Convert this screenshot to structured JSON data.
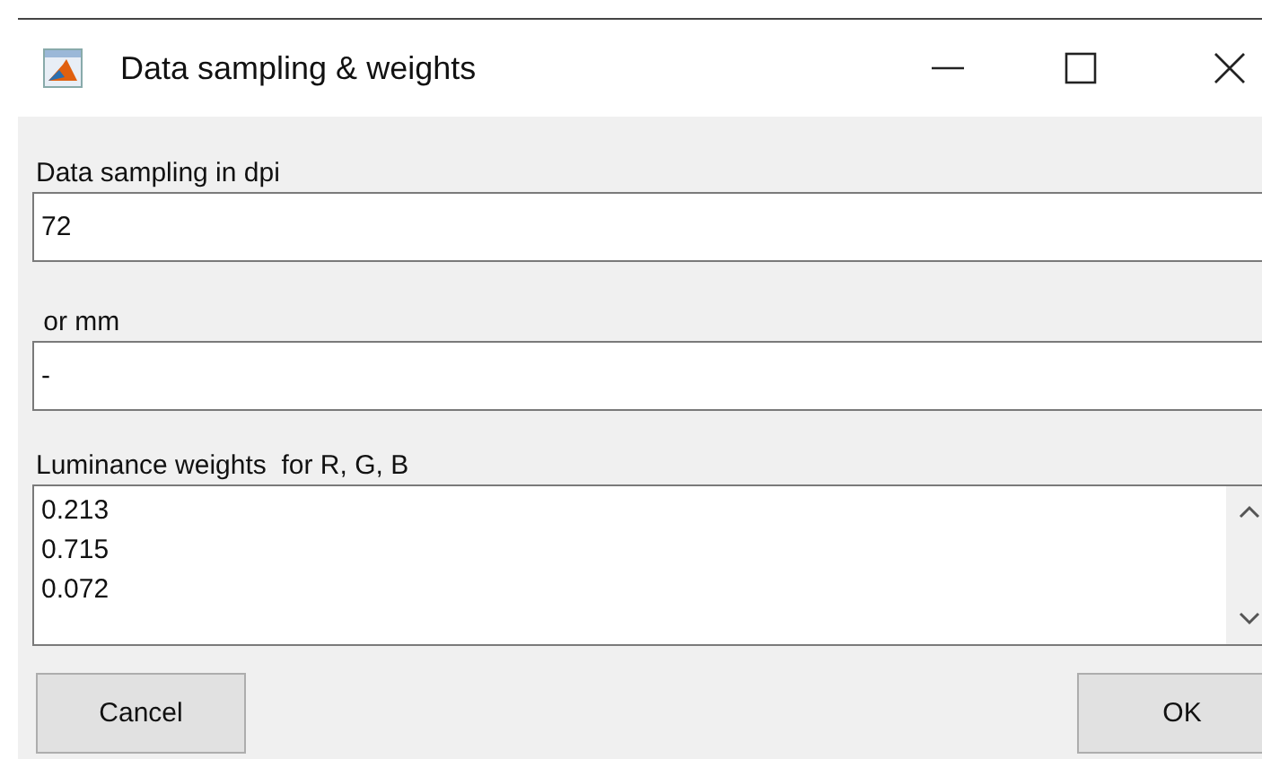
{
  "window": {
    "title": "Data sampling & weights"
  },
  "fields": [
    {
      "label": "Data sampling in dpi",
      "value": "72"
    },
    {
      "label": " or mm",
      "value": "-"
    }
  ],
  "weights": {
    "label": "Luminance weights  for R, G, B",
    "lines": [
      "0.213",
      "0.715",
      "0.072"
    ]
  },
  "buttons": [
    "Cancel",
    "OK"
  ]
}
